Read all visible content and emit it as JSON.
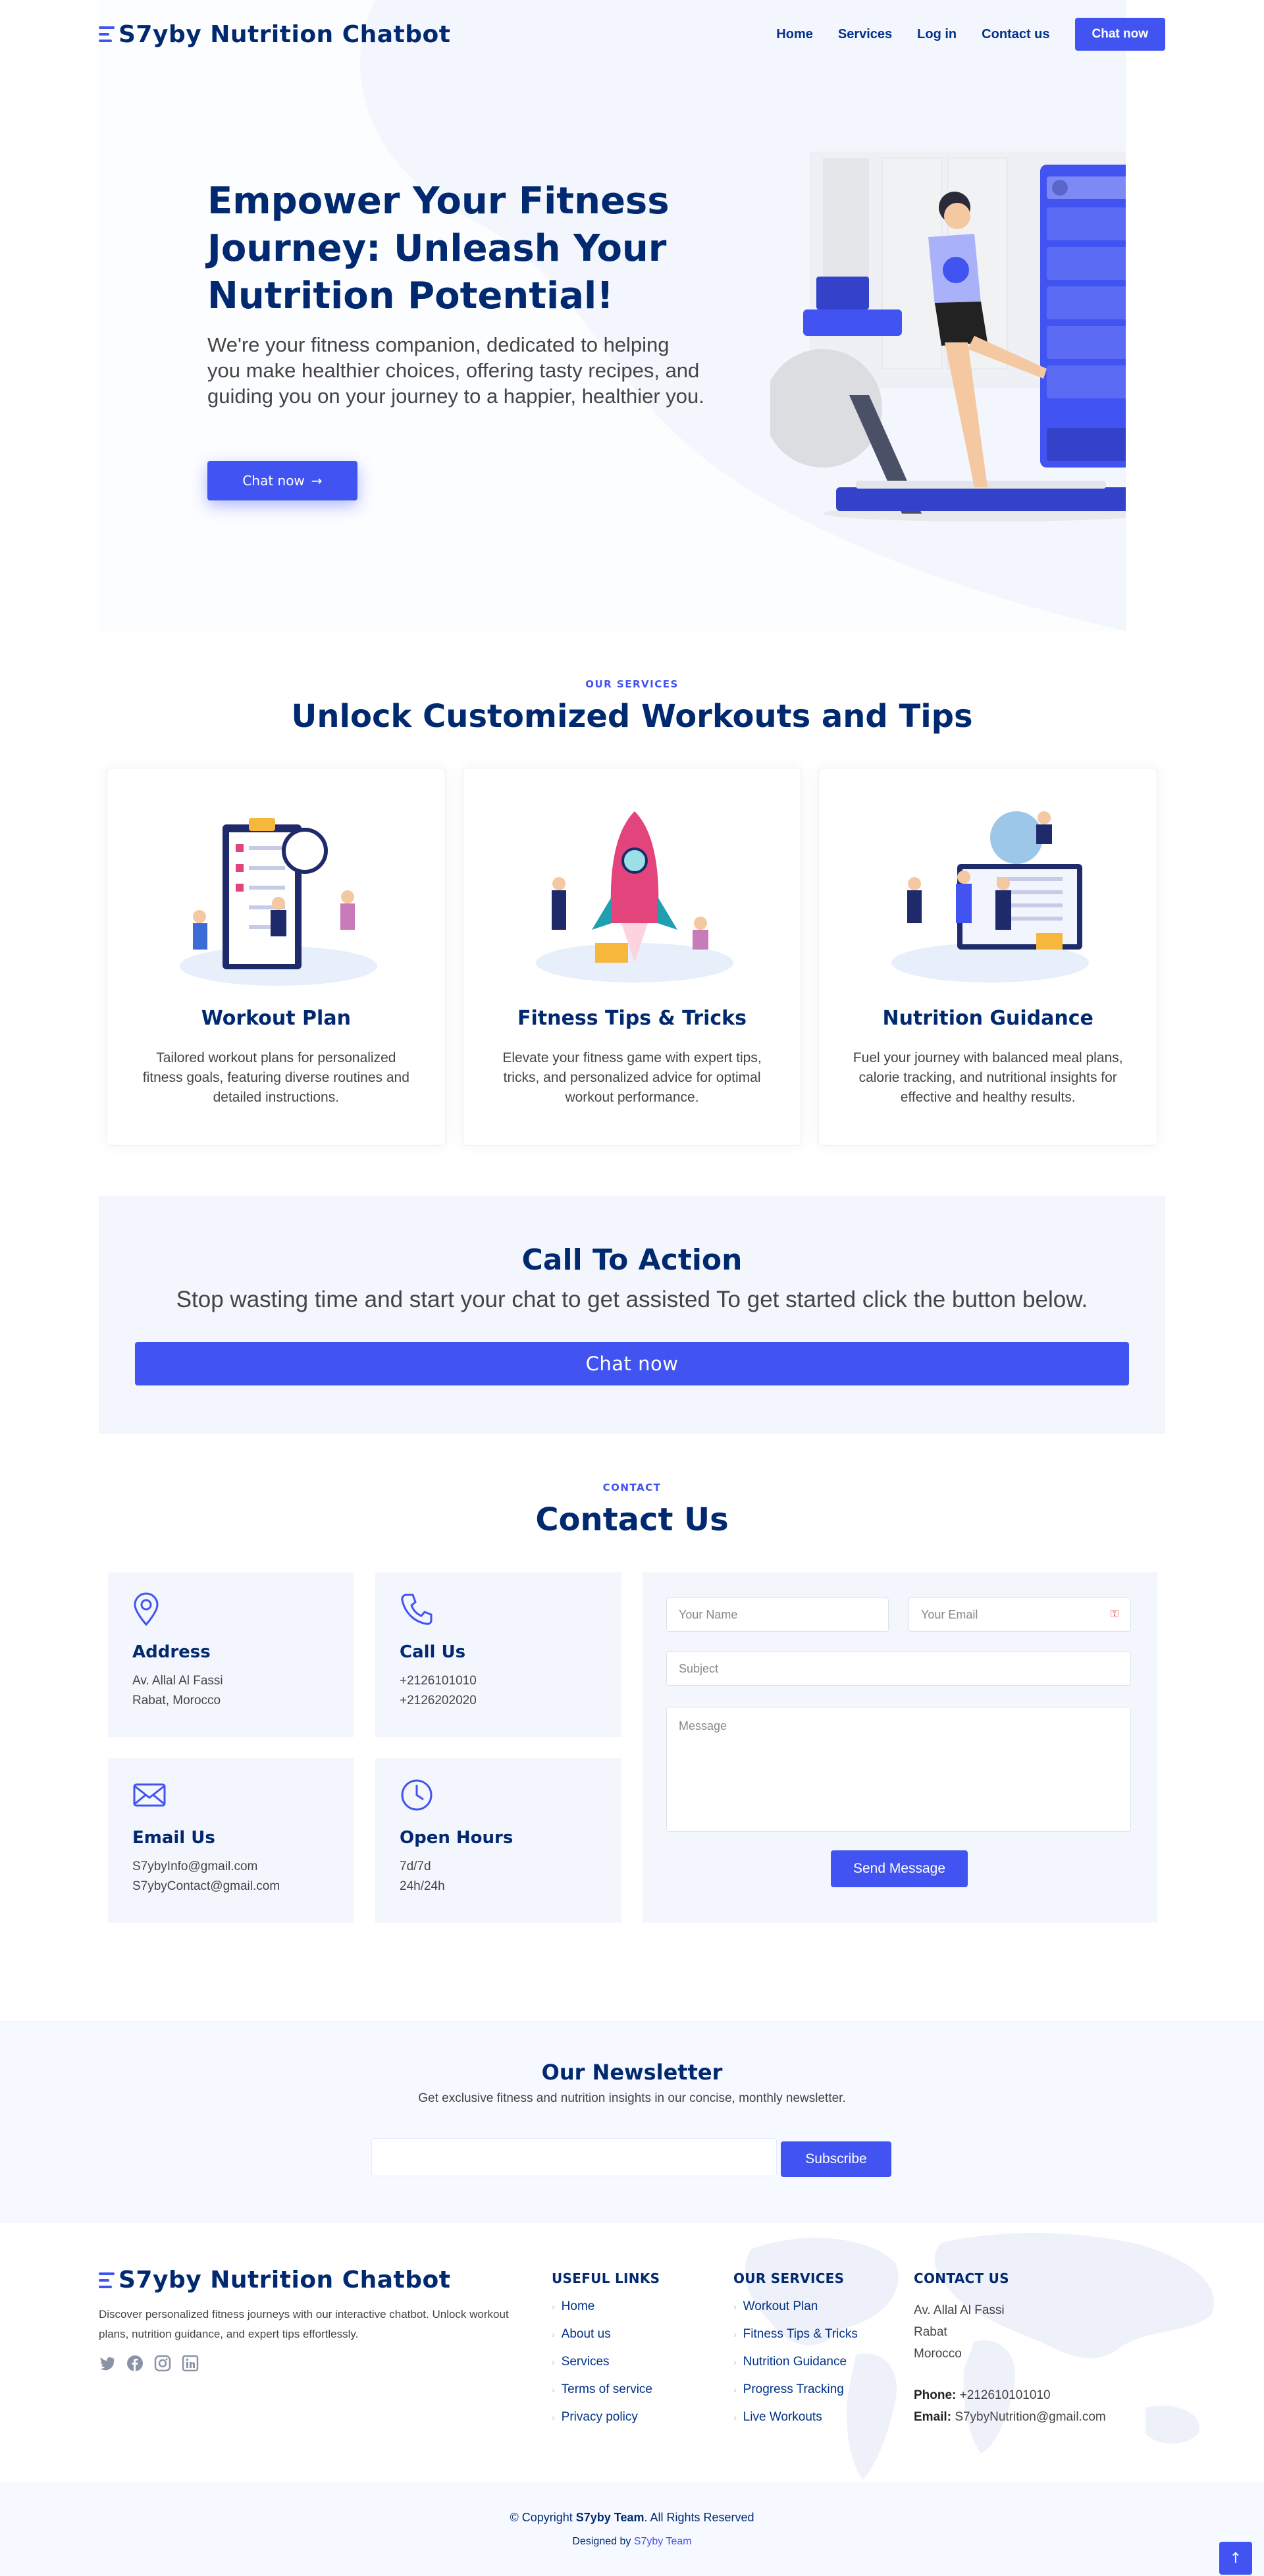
{
  "header": {
    "brand": "S7yby Nutrition Chatbot",
    "nav": [
      "Home",
      "Services",
      "Log in",
      "Contact us"
    ],
    "cta": "Chat now"
  },
  "hero": {
    "title": "Empower Your Fitness Journey: Unleash Your Nutrition Potential!",
    "subtitle": "We're your fitness companion, dedicated to helping you make healthier choices, offering tasty recipes, and guiding you on your journey to a happier, healthier you.",
    "button": "Chat now",
    "button_icon": "arrow-right-icon",
    "illustration": "treadmill-phone-illustration"
  },
  "services": {
    "label": "OUR SERVICES",
    "title": "Unlock Customized Workouts and Tips",
    "cards": [
      {
        "title": "Workout Plan",
        "desc": "Tailored workout plans for personalized fitness goals, featuring diverse routines and detailed instructions."
      },
      {
        "title": "Fitness Tips & Tricks",
        "desc": "Elevate your fitness game with expert tips, tricks, and personalized advice for optimal workout performance."
      },
      {
        "title": "Nutrition Guidance",
        "desc": "Fuel your journey with balanced meal plans, calorie tracking, and nutritional insights for effective and healthy results."
      }
    ]
  },
  "cta": {
    "title": "Call To Action",
    "subtitle": "Stop wasting time and start your chat to get assisted To get started click the button below.",
    "button": "Chat now"
  },
  "contact": {
    "label": "CONTACT",
    "title": "Contact Us",
    "info": [
      {
        "title": "Address",
        "lines": [
          "Av. Allal Al Fassi",
          "Rabat, Morocco"
        ],
        "icon": "map-pin-icon"
      },
      {
        "title": "Call Us",
        "lines": [
          "+2126101010",
          "+2126202020"
        ],
        "icon": "phone-icon"
      },
      {
        "title": "Email Us",
        "lines": [
          "S7ybyInfo@gmail.com",
          "S7ybyContact@gmail.com"
        ],
        "icon": "envelope-icon"
      },
      {
        "title": "Open Hours",
        "lines": [
          "7d/7d",
          "24h/24h"
        ],
        "icon": "clock-icon"
      }
    ],
    "form": {
      "name_placeholder": "Your Name",
      "email_placeholder": "Your Email",
      "subject_placeholder": "Subject",
      "message_placeholder": "Message",
      "send": "Send Message"
    }
  },
  "newsletter": {
    "title": "Our Newsletter",
    "text": "Get exclusive fitness and nutrition insights in our concise, monthly newsletter.",
    "button": "Subscribe"
  },
  "footer": {
    "brand": "S7yby Nutrition Chatbot",
    "about": "Discover personalized fitness journeys with our interactive chatbot. Unlock workout plans, nutrition guidance, and expert tips effortlessly.",
    "social": [
      "twitter-icon",
      "facebook-icon",
      "instagram-icon",
      "linkedin-icon"
    ],
    "useful_links": {
      "title": "USEFUL LINKS",
      "items": [
        "Home",
        "About us",
        "Services",
        "Terms of service",
        "Privacy policy"
      ]
    },
    "our_services": {
      "title": "OUR SERVICES",
      "items": [
        "Workout Plan",
        "Fitness Tips & Tricks",
        "Nutrition Guidance",
        "Progress Tracking",
        "Live Workouts"
      ]
    },
    "contact": {
      "title": "CONTACT US",
      "lines": [
        "Av. Allal Al Fassi",
        "Rabat",
        "Morocco"
      ],
      "phone_label": "Phone:",
      "phone": "+212610101010",
      "email_label": "Email:",
      "email": "S7ybyNutrition@gmail.com"
    },
    "copyright_prefix": "© Copyright ",
    "copyright_team": "S7yby Team",
    "copyright_suffix": ". All Rights Reserved",
    "designed_prefix": "Designed by ",
    "designed_by": "S7yby Team"
  },
  "colors": {
    "primary": "#4154f1",
    "heading": "#012970",
    "light_bg": "#f4f6fe"
  }
}
